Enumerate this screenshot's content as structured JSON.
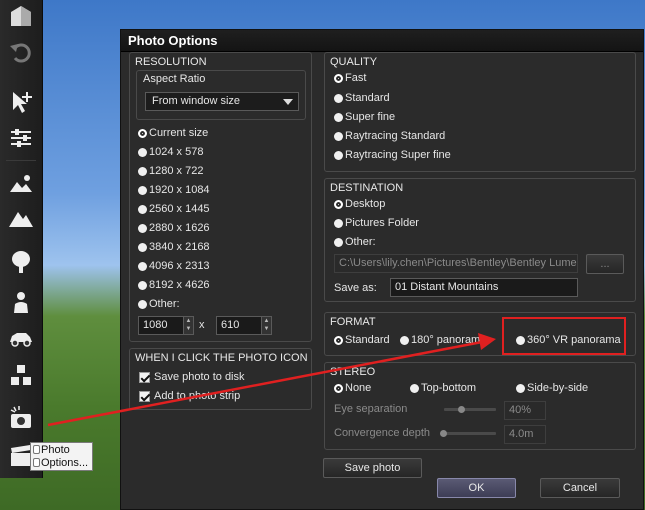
{
  "dialog": {
    "title": "Photo Options",
    "resolution": {
      "title": "RESOLUTION",
      "aspect_ratio_label": "Aspect Ratio",
      "aspect_ratio_value": "From window size",
      "options": [
        "Current size",
        "1024 x 578",
        "1280 x 722",
        "1920 x 1084",
        "2560 x 1445",
        "2880 x 1626",
        "3840 x 2168",
        "4096 x 2313",
        "8192 x 4626",
        "Other:"
      ],
      "selected": "Current size",
      "width_value": "1080",
      "height_value": "610",
      "x_label": "x"
    },
    "click_icon": {
      "title": "WHEN I CLICK THE PHOTO ICON",
      "save_to_disk": "Save photo to disk",
      "add_to_strip": "Add to photo strip"
    },
    "quality": {
      "title": "QUALITY",
      "options": [
        "Fast",
        "Standard",
        "Super fine",
        "Raytracing Standard",
        "Raytracing Super fine"
      ],
      "selected": "Fast"
    },
    "destination": {
      "title": "DESTINATION",
      "options": [
        "Desktop",
        "Pictures Folder",
        "Other:"
      ],
      "selected": "Desktop",
      "path_value": "C:\\Users\\lily.chen\\Pictures\\Bentley\\Bentley Lumen",
      "browse_label": "...",
      "save_as_label": "Save as:",
      "save_as_value": "01 Distant Mountains"
    },
    "format": {
      "title": "FORMAT",
      "options": [
        "Standard",
        "180° panorama",
        "360° VR panorama"
      ],
      "selected": "Standard"
    },
    "stereo": {
      "title": "STEREO",
      "options": [
        "None",
        "Top-bottom",
        "Side-by-side"
      ],
      "selected": "None",
      "eye_sep_label": "Eye separation",
      "eye_sep_value": "40%",
      "convergence_label": "Convergence depth",
      "convergence_value": "4.0m"
    },
    "save_photo_label": "Save photo",
    "ok_label": "OK",
    "cancel_label": "Cancel"
  },
  "tooltip": {
    "line1": "Photo",
    "line2": "Options..."
  },
  "colors": {
    "highlight": "#e02020",
    "dialog_bg": "#2b2b2b"
  }
}
